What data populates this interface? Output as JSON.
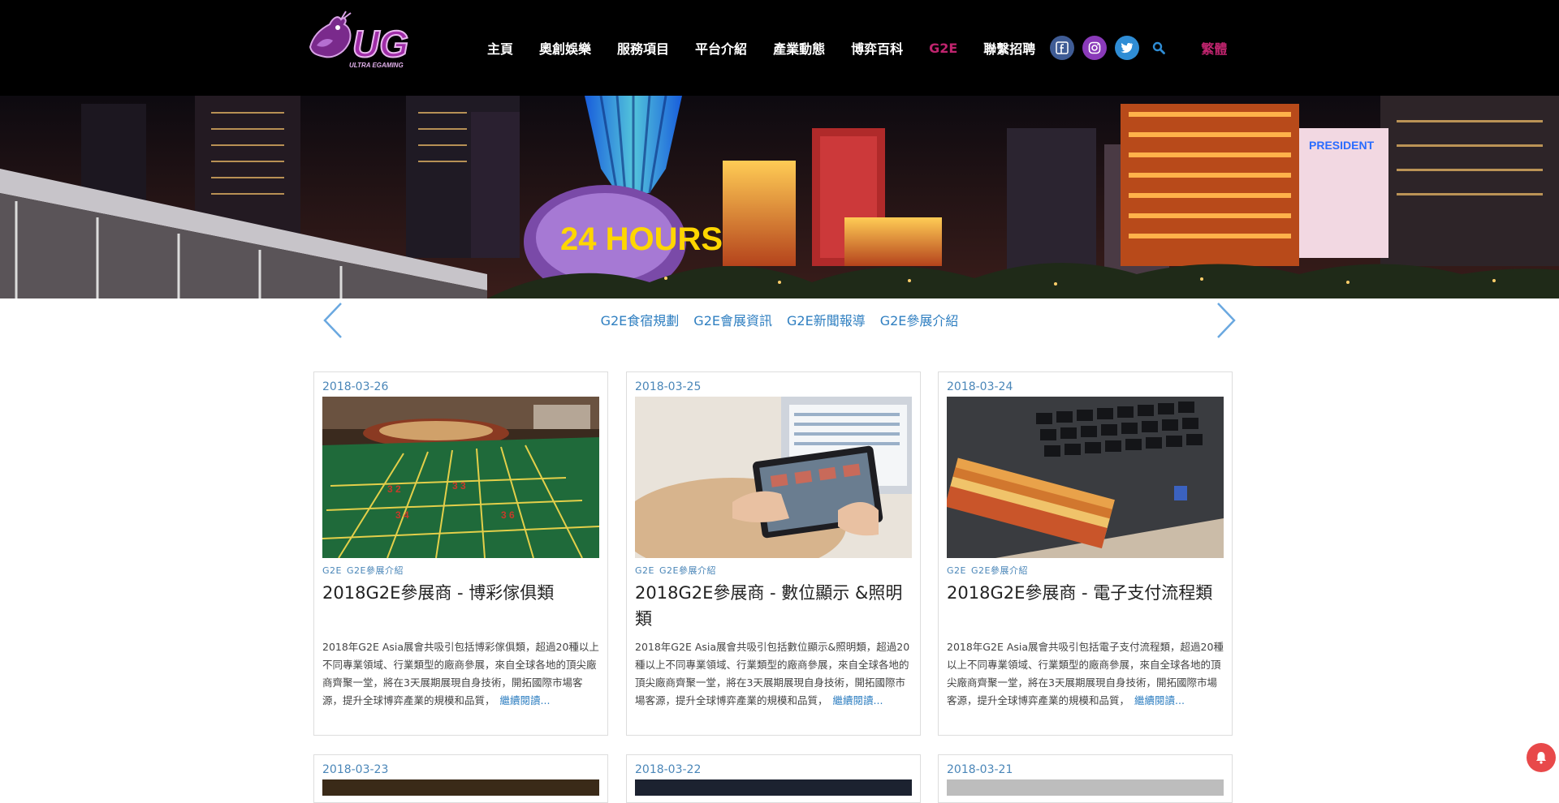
{
  "header": {
    "logo_text": "UG",
    "logo_subtext": "ULTRA EGAMING",
    "nav": [
      {
        "label": "主頁",
        "name": "nav-home"
      },
      {
        "label": "奧創娛樂",
        "name": "nav-ultra-entertainment"
      },
      {
        "label": "服務項目",
        "name": "nav-services"
      },
      {
        "label": "平台介紹",
        "name": "nav-platform"
      },
      {
        "label": "產業動態",
        "name": "nav-industry-news"
      },
      {
        "label": "博弈百科",
        "name": "nav-gaming-wiki"
      },
      {
        "label": "G2E",
        "name": "nav-g2e",
        "active": true
      },
      {
        "label": "聯繫招聘",
        "name": "nav-contact-recruit"
      }
    ],
    "social": [
      "facebook-icon",
      "instagram-icon",
      "twitter-icon"
    ],
    "lang_label": "繁體",
    "active_color": "#c0246e"
  },
  "hero": {
    "sign_1": "PRESIDENT",
    "sign_2": "24 HOURS"
  },
  "subnav": {
    "links": [
      "G2E食宿規劃",
      "G2E會展資訊",
      "G2E新聞報導",
      "G2E參展介紹"
    ]
  },
  "posts": [
    {
      "date": "2018-03-26",
      "cats": [
        "G2E",
        "G2E參展介紹"
      ],
      "title": "2018G2E參展商 - 博彩傢俱類",
      "excerpt": "2018年G2E Asia展會共吸引包括博彩傢俱類，超過20種以上不同專業領域、行業類型的廠商參展，來自全球各地的頂尖廠商齊聚一堂，將在3天展期展現自身技術，開拓國際市場客源，提升全球博弈產業的規模和品質，",
      "read_more": "繼續閱讀...",
      "image": "roulette-table-image"
    },
    {
      "date": "2018-03-25",
      "cats": [
        "G2E",
        "G2E參展介紹"
      ],
      "title": "2018G2E參展商 - 數位顯示 &照明類",
      "excerpt": "2018年G2E Asia展會共吸引包括數位顯示&照明類，超過20種以上不同專業領域、行業類型的廠商參展，來自全球各地的頂尖廠商齊聚一堂，將在3天展期展現自身技術，開拓國際市場客源，提升全球博弈產業的規模和品質，",
      "read_more": "繼續閱讀...",
      "image": "tablet-user-image"
    },
    {
      "date": "2018-03-24",
      "cats": [
        "G2E",
        "G2E參展介紹"
      ],
      "title": "2018G2E參展商 - 電子支付流程類",
      "excerpt": "2018年G2E Asia展會共吸引包括電子支付流程類，超過20種以上不同專業領域、行業類型的廠商參展，來自全球各地的頂尖廠商齊聚一堂，將在3天展期展現自身技術，開拓國際市場客源，提升全球博弈產業的規模和品質，",
      "read_more": "繼續閱讀...",
      "image": "laptop-cash-image"
    },
    {
      "date": "2018-03-23"
    },
    {
      "date": "2018-03-22"
    },
    {
      "date": "2018-03-21"
    }
  ]
}
